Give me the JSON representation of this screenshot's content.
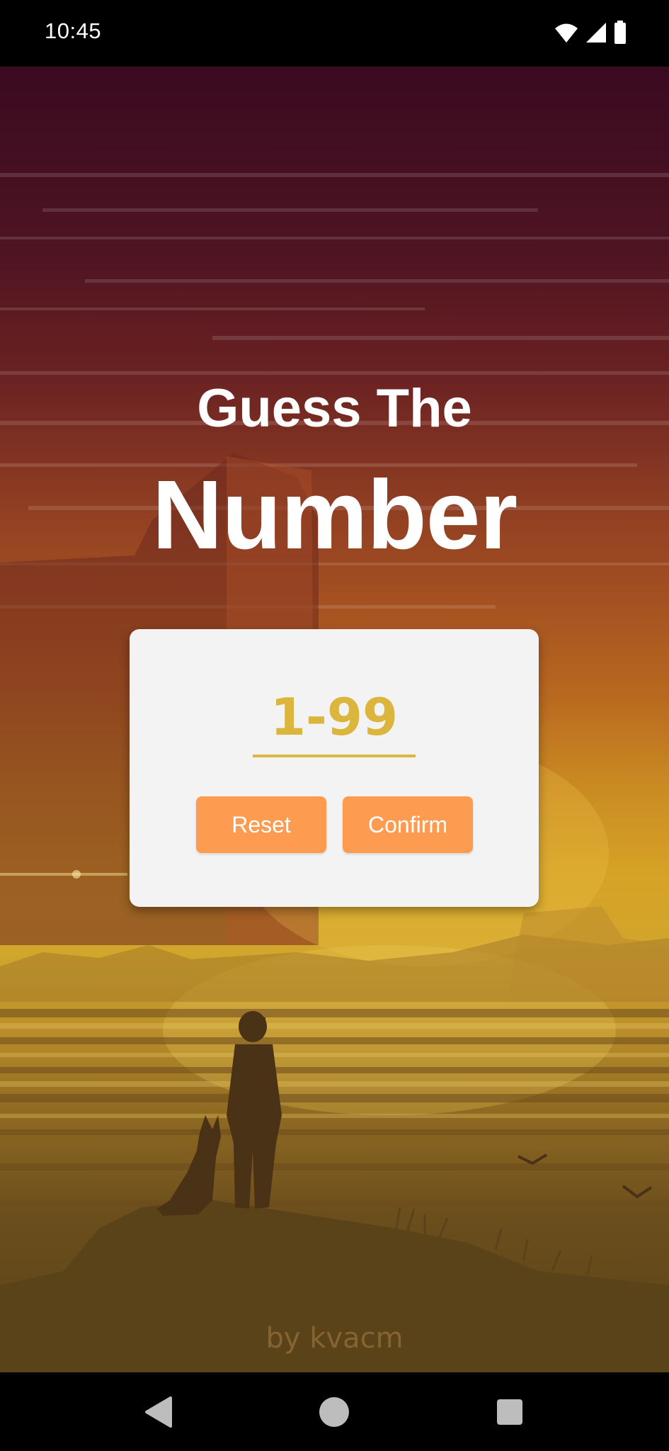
{
  "status_bar": {
    "time": "10:45",
    "icons": [
      "wifi-icon",
      "cellular-signal-icon",
      "battery-icon"
    ]
  },
  "title": {
    "line1": "Guess The",
    "line2": "Number"
  },
  "card": {
    "range_value": "1-99",
    "reset_label": "Reset",
    "confirm_label": "Confirm"
  },
  "credit": "by kvacm",
  "navigation": {
    "back": "back-icon",
    "home": "home-icon",
    "recent": "recent-apps-icon"
  },
  "colors": {
    "accent_gold": "#dbb53c",
    "button_orange": "#fd9b51",
    "card_bg": "#f3f3f3"
  }
}
